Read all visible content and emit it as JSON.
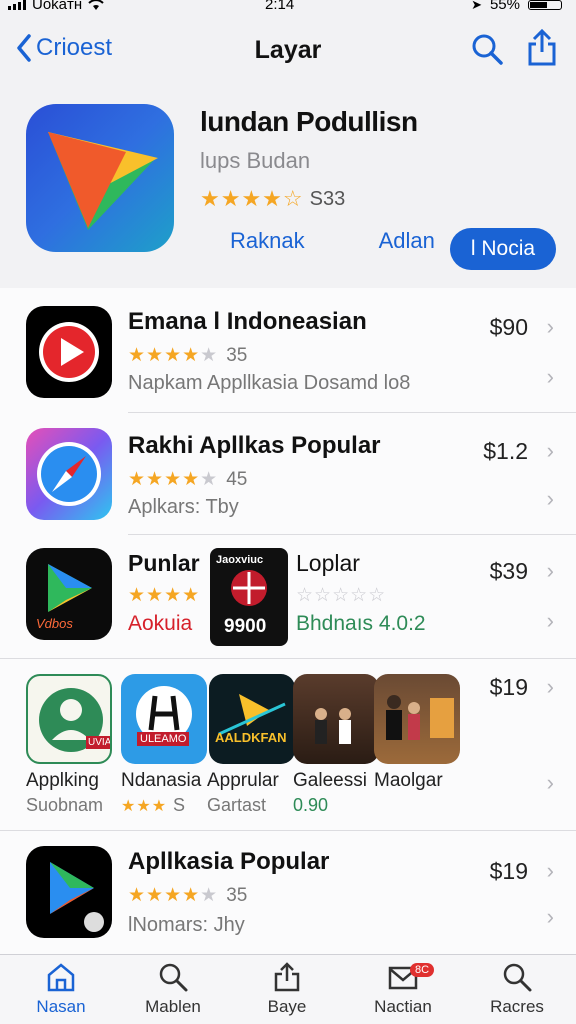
{
  "status": {
    "carrier": "Uokaтн",
    "time": "2:14",
    "battery": "55%"
  },
  "nav": {
    "back_label": "Crioest",
    "title": "Layar"
  },
  "hero": {
    "title": "lundan Podullisn",
    "subtitle": "lups Budan",
    "rating_count": "S33",
    "action1": "Raknak",
    "action2": "Adlan",
    "primary": "l Nocia"
  },
  "rows": [
    {
      "title": "Emana l Indoneasian",
      "rating_count": "35",
      "subtitle": "Napkam Appllkasia Dosamd lo8",
      "price": "$90"
    },
    {
      "title": "Rakhi Apllkas Popular",
      "rating_count": "45",
      "subtitle": "Aplkars: Tby",
      "price": "$1.2"
    },
    {
      "title": "Punlar",
      "subtitle": "Aokuia",
      "title2": "Loplar",
      "subtitle2": "Bhdnaıs 4.0:2",
      "price": "$39",
      "icon_text": "Vdbos",
      "icon2_text": "9900",
      "icon2_top": "Jaoxviuc"
    },
    {
      "price": "$19"
    },
    {
      "title": "Apllkasia Popular",
      "rating_count": "35",
      "subtitle": "lNomars: Jhy",
      "price": "$19"
    }
  ],
  "gallery": [
    {
      "label": "Applking",
      "sub": "Suobnam",
      "icon_text": "UVIAN"
    },
    {
      "label": "Ndanasia",
      "sub": "S",
      "icon_text": "ULEAMO"
    },
    {
      "label": "Apprular",
      "sub": "Gartast",
      "icon_text": "AALDKFAN"
    },
    {
      "label": "Galeessi",
      "sub": "0.90"
    },
    {
      "label": "Maolgar",
      "sub": ""
    }
  ],
  "tabs": [
    {
      "label": "Nasan"
    },
    {
      "label": "Mablen"
    },
    {
      "label": "Baye"
    },
    {
      "label": "Nactian",
      "badge": "8C"
    },
    {
      "label": "Racres"
    }
  ],
  "colors": {
    "accent": "#1a63d4",
    "star": "#f5a623",
    "green": "#2e8b57",
    "red": "#d6202a"
  }
}
